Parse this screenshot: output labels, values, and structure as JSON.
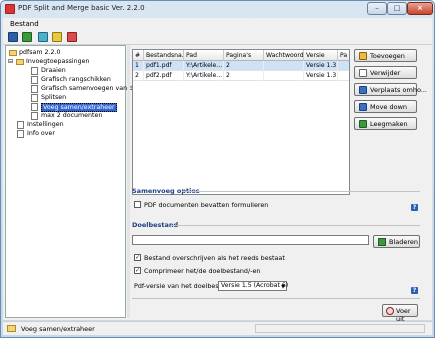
{
  "window": {
    "title": "PDF Split and Merge basic Ver. 2.2.0",
    "controls": {
      "minimize": "–",
      "maximize": "□",
      "close": "×"
    }
  },
  "menu": {
    "items": [
      "Bestand"
    ]
  },
  "toolbar": {
    "icons": [
      "save-icon",
      "open-icon",
      "export-icon",
      "edit-icon",
      "close-icon"
    ]
  },
  "tree": {
    "root": "pdfsam 2.2.0",
    "plugins_group": "Invoegtoepassingen",
    "plugins": [
      "Draaien",
      "Grafisch rangschikken",
      "Grafisch samenvoegen van doc",
      "Splitsen",
      "Voeg samen/extraheer",
      "max 2 documenten"
    ],
    "settings": "Instellingen",
    "about": "Info over",
    "selected": "Voeg samen/extraheer"
  },
  "table": {
    "columns": [
      "#",
      "Bestandsna...",
      "Pad",
      "Pagina's",
      "Wachtwoord",
      "Versie",
      "Pa"
    ],
    "rows": [
      [
        "1",
        "pdf1.pdf",
        "Y:\\Artikele...",
        "2",
        "",
        "Versie 1.3 (...",
        ""
      ],
      [
        "2",
        "pdf2.pdf",
        "Y:\\Artikele...",
        "2",
        "",
        "Versie 1.3 (...",
        ""
      ]
    ]
  },
  "buttons": {
    "add": "Toevoegen",
    "remove": "Verwijder",
    "move_up": "Verplaats omho...",
    "move_down": "Move down",
    "clear": "Leegmaken"
  },
  "merge_options": {
    "title": "Samenvoeg opties",
    "forms_label": "PDF documenten bevatten formulieren",
    "forms_checked": false
  },
  "destination": {
    "title": "Doelbestand",
    "path_value": "",
    "browse": "Bladeren",
    "overwrite_label": "Bestand overschrijven als het reeds bestaat",
    "overwrite_checked": true,
    "compress_label": "Comprimeer het/de doelbestand/-en",
    "compress_checked": true,
    "version_label": "Pdf-versie van het doelbestand:",
    "version_value": "Versie 1.5 (Acrobat 6)"
  },
  "run_button": "Voer uit",
  "help_label": "?",
  "status": {
    "text": "Voeg samen/extraheer"
  },
  "colors": {
    "selection": "#3366cc",
    "section_title": "#1b3f82",
    "help": "#2a5fb5"
  }
}
